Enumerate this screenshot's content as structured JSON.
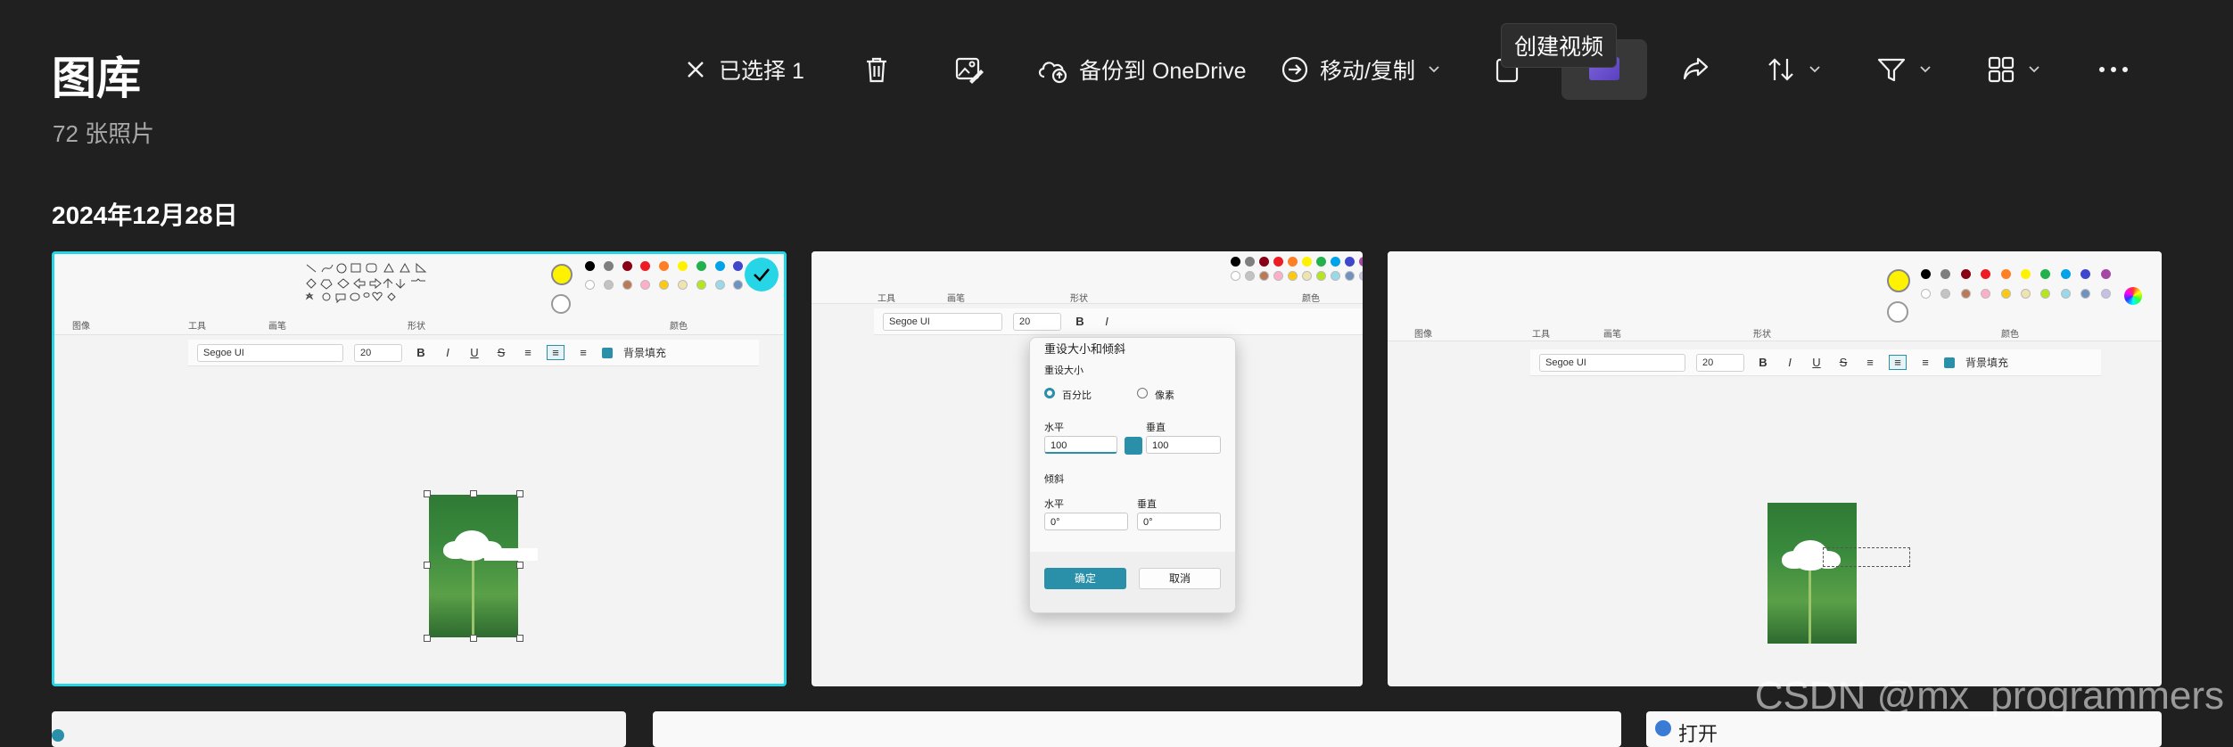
{
  "header": {
    "title": "图库",
    "subtitle": "72 张照片"
  },
  "toolbar": {
    "selected_label": "已选择 1",
    "backup_label": "备份到 OneDrive",
    "move_copy_label": "移动/复制",
    "tooltip": "创建视频",
    "icons": [
      "close-icon",
      "delete-icon",
      "edit-image-icon",
      "cloud-backup-icon",
      "move-icon",
      "video-icon",
      "share-icon",
      "sort-icon",
      "filter-icon",
      "view-icon",
      "more-icon"
    ]
  },
  "group": {
    "date": "2024年12月28日"
  },
  "paint": {
    "font_name": "Segoe UI",
    "font_size": "20",
    "bg_fill": "背景填充",
    "groups": {
      "image": "图像",
      "tools": "工具",
      "brush": "画笔",
      "shapes": "形状",
      "colors": "颜色"
    },
    "format": {
      "bold": "B",
      "italic": "I",
      "underline": "U",
      "strike": "S"
    },
    "palette": [
      "#000000",
      "#7f7f7f",
      "#880015",
      "#ed1c24",
      "#ff7f27",
      "#fff200",
      "#22b14c",
      "#00a2e8",
      "#3f48cc",
      "#a349a4"
    ],
    "palette2": [
      "#ffffff",
      "#c3c3c3",
      "#b97a57",
      "#ffaec9",
      "#ffc90e",
      "#efe4b0",
      "#b5e61d",
      "#99d9ea",
      "#7092be",
      "#c8bfe7"
    ],
    "selected_color": "#fff200"
  },
  "dialog": {
    "title": "重设大小和倾斜",
    "resize_label": "重设大小",
    "percent": "百分比",
    "pixels": "像素",
    "horizontal": "水平",
    "vertical": "垂直",
    "h_value": "100",
    "v_value": "100",
    "skew_label": "倾斜",
    "skew_h": "0°",
    "skew_v": "0°",
    "ok": "确定",
    "cancel": "取消"
  },
  "bottom_row": {
    "open_label": "打开"
  },
  "colors": {
    "selection": "#27d6e6",
    "background": "#202020",
    "accent": "#2a8fa8"
  },
  "watermark": "CSDN @mx_programmers"
}
